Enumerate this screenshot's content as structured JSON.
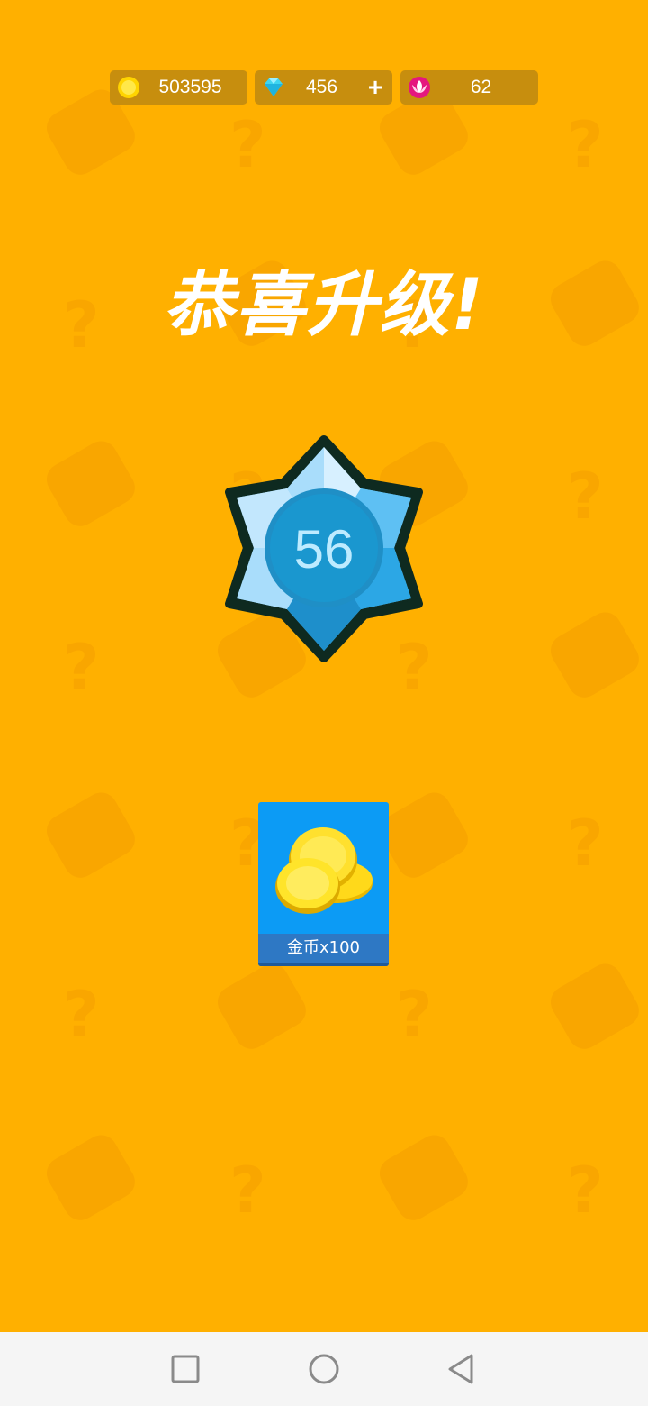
{
  "currencies": {
    "coins": {
      "value": "503595",
      "icon": "gold-coin-icon"
    },
    "gems": {
      "value": "456",
      "icon": "diamond-icon",
      "add_label": "+"
    },
    "lotus": {
      "value": "62",
      "icon": "lotus-icon"
    }
  },
  "title": "恭喜升级!",
  "level": {
    "value": "56"
  },
  "reward": {
    "label": "金币x100",
    "icon": "gold-coins-pile-icon"
  },
  "navbar": {
    "recent_icon": "square-icon",
    "home_icon": "circle-icon",
    "back_icon": "triangle-back-icon"
  },
  "colors": {
    "background": "#FFB000",
    "currency_bg": "#C78E0E",
    "reward_card": "#0C9BF5",
    "badge_blue": "#4FB8F0"
  }
}
